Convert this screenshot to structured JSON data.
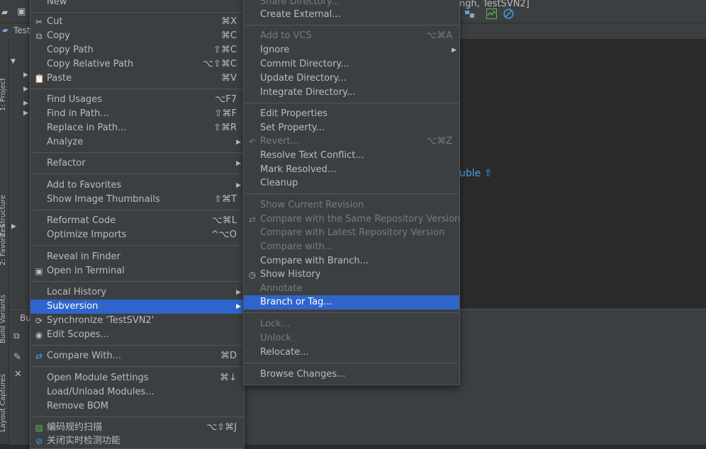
{
  "window": {
    "tab_title_partial": "Test",
    "breadcrumb_partial": "ngh, TestSVN2]",
    "editor_hint_partial": "uble ⇧",
    "bottom_tab_partial": "Bu"
  },
  "sidebar": {
    "project_label": "1: Project",
    "structure_label": "Z: Structure",
    "favorites_label": "2: Favorites",
    "build_variants_label": "Build Variants",
    "layout_captures_label": "Layout Captures"
  },
  "context_menu": {
    "new_label": "New",
    "cut": {
      "label": "Cut",
      "shortcut": "⌘X"
    },
    "copy": {
      "label": "Copy",
      "shortcut": "⌘C"
    },
    "copy_path": {
      "label": "Copy Path",
      "shortcut": "⇧⌘C"
    },
    "copy_relative_path": {
      "label": "Copy Relative Path",
      "shortcut": "⌥⇧⌘C"
    },
    "paste": {
      "label": "Paste",
      "shortcut": "⌘V"
    },
    "find_usages": {
      "label": "Find Usages",
      "shortcut": "⌥F7"
    },
    "find_in_path": {
      "label": "Find in Path...",
      "shortcut": "⇧⌘F"
    },
    "replace_in_path": {
      "label": "Replace in Path...",
      "shortcut": "⇧⌘R"
    },
    "analyze": {
      "label": "Analyze"
    },
    "refactor": {
      "label": "Refactor"
    },
    "add_to_favorites": {
      "label": "Add to Favorites"
    },
    "show_image_thumbnails": {
      "label": "Show Image Thumbnails",
      "shortcut": "⇧⌘T"
    },
    "reformat_code": {
      "label": "Reformat Code",
      "shortcut": "⌥⌘L"
    },
    "optimize_imports": {
      "label": "Optimize Imports",
      "shortcut": "^⌥O"
    },
    "reveal_in_finder": {
      "label": "Reveal in Finder"
    },
    "open_in_terminal": {
      "label": "Open in Terminal"
    },
    "local_history": {
      "label": "Local History"
    },
    "subversion": {
      "label": "Subversion"
    },
    "synchronize": {
      "label": "Synchronize 'TestSVN2'"
    },
    "edit_scopes": {
      "label": "Edit Scopes..."
    },
    "compare_with": {
      "label": "Compare With...",
      "shortcut": "⌘D"
    },
    "open_module_settings": {
      "label": "Open Module Settings",
      "shortcut": "⌘↓"
    },
    "load_unload_modules": {
      "label": "Load/Unload Modules..."
    },
    "remove_bom": {
      "label": "Remove BOM"
    },
    "code_scan": {
      "label": "编码规约扫描",
      "shortcut": "⌥⇧⌘J"
    },
    "close_realtime_check": {
      "label": "关闭实时检测功能"
    }
  },
  "subversion_menu": {
    "share_directory": {
      "label": "Share Directory..."
    },
    "create_external": {
      "label": "Create External..."
    },
    "add_to_vcs": {
      "label": "Add to VCS",
      "shortcut": "⌥⌘A"
    },
    "ignore": {
      "label": "Ignore"
    },
    "commit_directory": {
      "label": "Commit Directory..."
    },
    "update_directory": {
      "label": "Update Directory..."
    },
    "integrate_directory": {
      "label": "Integrate Directory..."
    },
    "edit_properties": {
      "label": "Edit Properties"
    },
    "set_property": {
      "label": "Set Property..."
    },
    "revert": {
      "label": "Revert...",
      "shortcut": "⌥⌘Z"
    },
    "resolve_text_conflict": {
      "label": "Resolve Text Conflict..."
    },
    "mark_resolved": {
      "label": "Mark Resolved..."
    },
    "cleanup": {
      "label": "Cleanup"
    },
    "show_current_revision": {
      "label": "Show Current Revision"
    },
    "compare_same_repo": {
      "label": "Compare with the Same Repository Version"
    },
    "compare_latest_repo": {
      "label": "Compare with Latest Repository Version"
    },
    "compare_with": {
      "label": "Compare with..."
    },
    "compare_with_branch": {
      "label": "Compare with Branch..."
    },
    "show_history": {
      "label": "Show History"
    },
    "annotate": {
      "label": "Annotate"
    },
    "branch_or_tag": {
      "label": "Branch or Tag..."
    },
    "lock": {
      "label": "Lock..."
    },
    "unlock": {
      "label": "Unlock"
    },
    "relocate": {
      "label": "Relocate..."
    },
    "browse_changes": {
      "label": "Browse Changes..."
    }
  },
  "colors": {
    "menu_bg": "#3c3f41",
    "selection": "#2f65ca",
    "disabled_text": "#7a7a7a",
    "text": "#bbbbbb"
  }
}
